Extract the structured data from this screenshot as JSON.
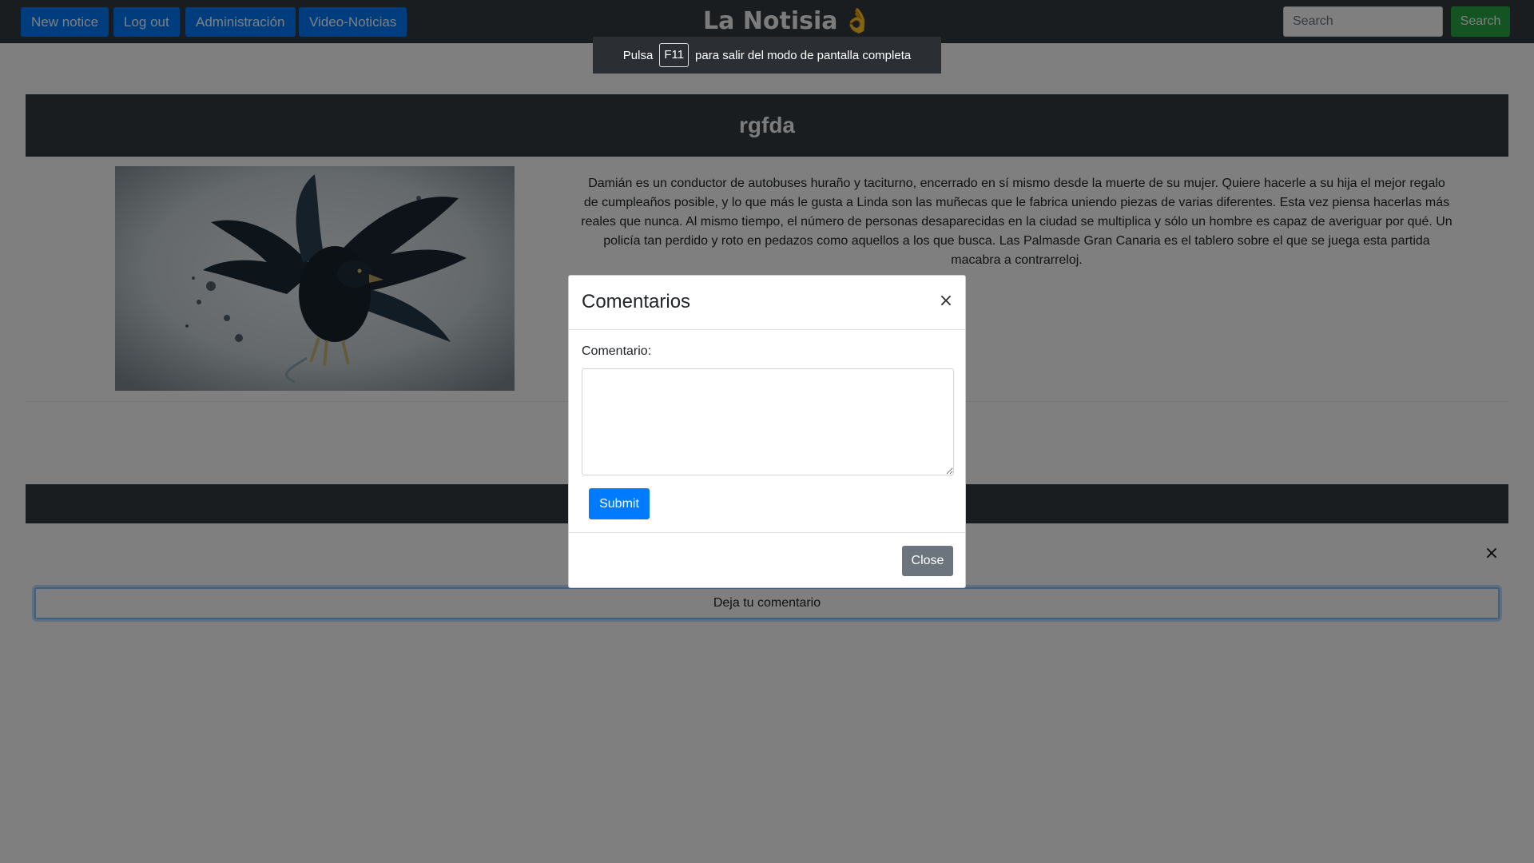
{
  "navbar": {
    "buttons": [
      "New notice",
      "Log out",
      "Administración",
      "Video-Noticias"
    ],
    "brand": "La Notisia",
    "brand_icon": "ok-hand-icon",
    "search_placeholder": "Search",
    "search_button": "Search"
  },
  "fullscreen_notice": {
    "before": "Pulsa",
    "key": "F11",
    "after": "para salir del modo de pantalla completa"
  },
  "article": {
    "title": "rgfda",
    "image": "eagle-image",
    "body": "Damián es un conductor de autobuses huraño y taciturno, encerrado en sí mismo desde la muerte de su mujer. Quiere hacerle a su hija el mejor regalo de cumpleaños posible, y lo que más le gusta a Linda son las muñecas que le fabrica uniendo piezas de varias diferentes. Esta vez piensa hacerlas más reales que nunca. Al mismo tiempo, el número de personas desaparecidas en la ciudad se multiplica y sólo un hombre es capaz de averiguar por qué. Un policía tan perdido y roto en pedazos como aquellos a los que busca. Las Palmasde Gran Canaria es el tablero sobre el que se juega esta partida macabra a contrarreloj."
  },
  "comments_section": {
    "close_symbol": "×",
    "leave_comment_button": "Deja tu comentario"
  },
  "modal": {
    "title": "Comentarios",
    "close_symbol": "×",
    "field_label": "Comentario:",
    "comment_value": "",
    "submit_label": "Submit",
    "close_label": "Close"
  },
  "colors": {
    "navbar_bg": "#343a40",
    "primary": "#007bff",
    "success": "#28a745",
    "secondary": "#6c757d"
  }
}
